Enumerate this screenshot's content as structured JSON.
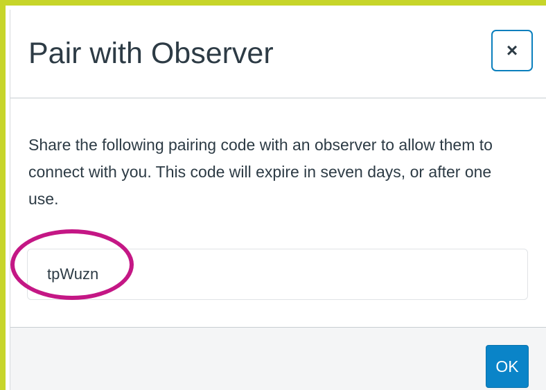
{
  "modal": {
    "title": "Pair with Observer",
    "close_icon": "close-icon",
    "close_glyph": "×",
    "description": "Share the following pairing code with an observer to allow them to connect with you. This code will expire in seven days, or after one use.",
    "pairing_code": "tpWuzn",
    "ok_label": "OK"
  },
  "colors": {
    "frame_accent": "#c7d52a",
    "highlight_oval": "#c41785",
    "button_blue": "#0a84c8",
    "title_text": "#2d3b45",
    "footer_background": "#f4f5f6"
  }
}
